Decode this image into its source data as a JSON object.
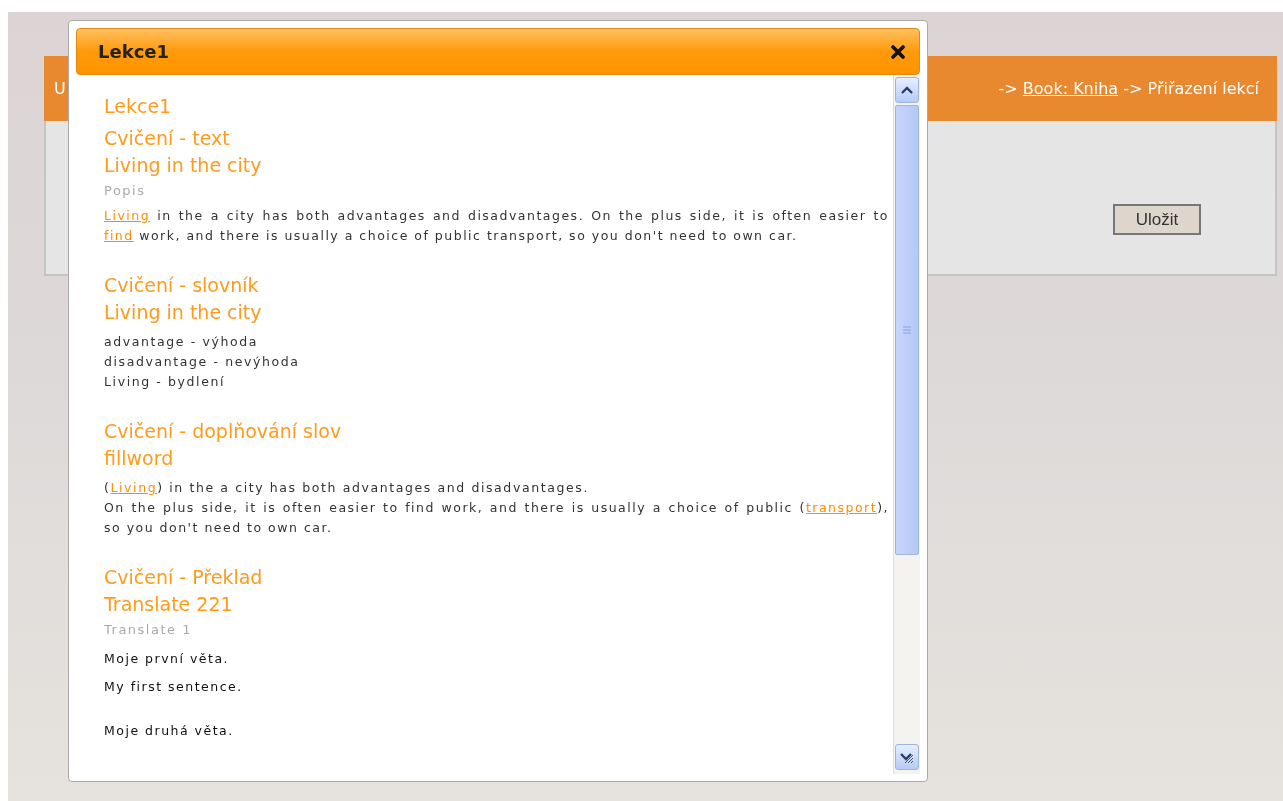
{
  "page": {
    "header_start": "U",
    "breadcrumb": [
      {
        "text": "->",
        "kind": "text"
      },
      {
        "text": "Book: Kniha",
        "kind": "link"
      },
      {
        "text": "-> Přiřazení lekcí",
        "kind": "text"
      }
    ],
    "save_button": "Uložit"
  },
  "dialog": {
    "title": "Lekce1",
    "heading": "Lekce1",
    "sections": [
      {
        "label": "Cvičení - text",
        "title": "Living in the city",
        "note": "Popis",
        "paragraphs": [
          {
            "kind": "text",
            "segments": [
              {
                "text": "Living",
                "kind": "link"
              },
              {
                "text": " in the a city has both advantages and disadvantages. On the plus side, it is often easier to ",
                "kind": "text"
              },
              {
                "text": "find",
                "kind": "link"
              },
              {
                "text": " work, and there is usually a choice of public transport, so you don't need to own car.",
                "kind": "text"
              }
            ]
          }
        ]
      },
      {
        "label": "Cvičení - slovník",
        "title": "Living in the city",
        "paragraphs": [
          {
            "kind": "line",
            "segments": [
              {
                "text": "advantage - výhoda",
                "kind": "text"
              }
            ]
          },
          {
            "kind": "line",
            "segments": [
              {
                "text": "disadvantage - nevýhoda",
                "kind": "text"
              }
            ]
          },
          {
            "kind": "line",
            "segments": [
              {
                "text": "Living - bydlení",
                "kind": "text"
              }
            ]
          }
        ]
      },
      {
        "label": "Cvičení - doplňování slov",
        "title": "fillword",
        "paragraphs": [
          {
            "kind": "line",
            "segments": [
              {
                "text": "(",
                "kind": "text"
              },
              {
                "text": "Living",
                "kind": "link"
              },
              {
                "text": ") in the a city has both advantages and disadvantages.",
                "kind": "text"
              }
            ]
          },
          {
            "kind": "text",
            "segments": [
              {
                "text": "On the plus side, it is often easier to find work, and there is usually a choice of public (",
                "kind": "text"
              },
              {
                "text": "transport",
                "kind": "link"
              },
              {
                "text": "), so you don't need to own car.",
                "kind": "text"
              }
            ]
          }
        ]
      },
      {
        "label": "Cvičení - Překlad",
        "title": "Translate 221",
        "note": "Translate 1",
        "paragraphs": [
          {
            "kind": "source",
            "segments": [
              {
                "text": "Moje první věta.",
                "kind": "text"
              }
            ]
          },
          {
            "kind": "target",
            "segments": [
              {
                "text": "My first sentence.",
                "kind": "text"
              }
            ]
          },
          {
            "kind": "source",
            "segments": [
              {
                "text": "Moje druhá věta.",
                "kind": "text"
              }
            ]
          }
        ]
      }
    ]
  }
}
